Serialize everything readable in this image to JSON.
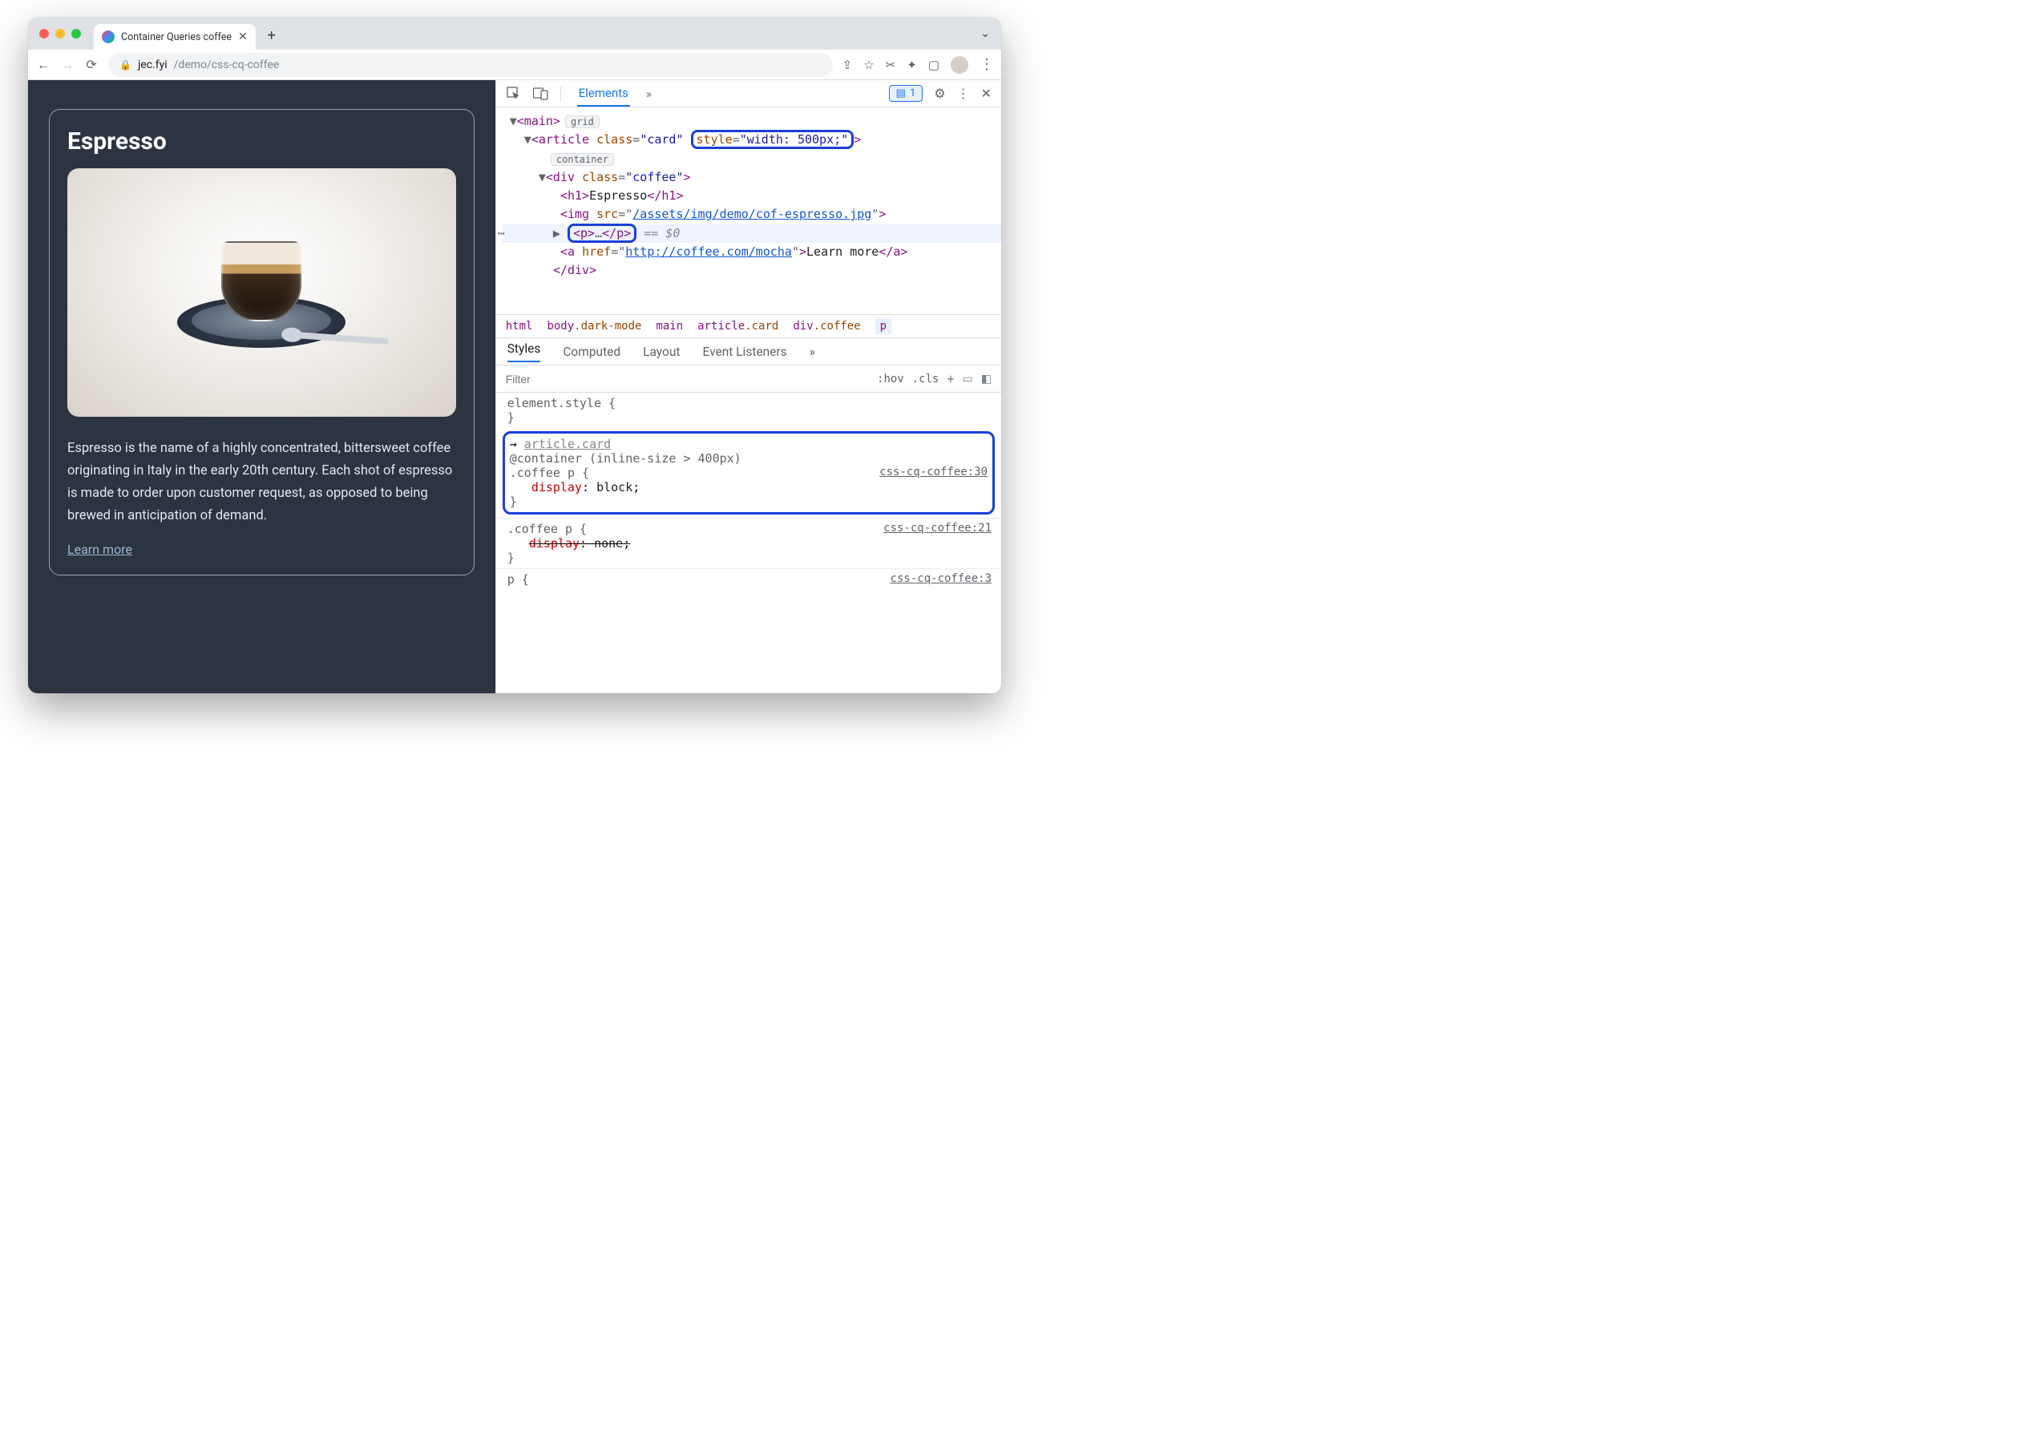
{
  "browser": {
    "tab_title": "Container Queries coffee",
    "url_host": "jec.fyi",
    "url_path": "/demo/css-cq-coffee"
  },
  "page": {
    "card_title": "Espresso",
    "card_body": "Espresso is the name of a highly concentrated, bittersweet coffee originating in Italy in the early 20th century. Each shot of espresso is made to order upon customer request, as opposed to being brewed in anticipation of demand.",
    "learn_more": "Learn more"
  },
  "devtools": {
    "panel_tab": "Elements",
    "issues_count": "1",
    "dom": {
      "main_open": "<main>",
      "grid_badge": "grid",
      "article_open_1": "<article ",
      "article_class_n": "class",
      "article_class_v": "\"card\"",
      "article_style": "style=\"width: 500px;\"",
      "article_open_2": ">",
      "container_badge": "container",
      "div_open": "<div class=\"coffee\">",
      "h1": "<h1>Espresso</h1>",
      "img_1": "<img src=\"",
      "img_href": "/assets/img/demo/cof-espresso.jpg",
      "img_2": "\">",
      "p_collapsed": "<p>…</p>",
      "eq_dollar": " == $0",
      "a_1": "<a href=\"",
      "a_href": "http://coffee.com/mocha",
      "a_2": "\">Learn more</a>",
      "div_close": "</div>"
    },
    "crumbs": {
      "c1": "html",
      "c2_a": "body",
      "c2_b": ".dark-mode",
      "c3": "main",
      "c4_a": "article",
      "c4_b": ".card",
      "c5_a": "div",
      "c5_b": ".coffee",
      "c6": "p"
    },
    "styles_tabs": {
      "t1": "Styles",
      "t2": "Computed",
      "t3": "Layout",
      "t4": "Event Listeners"
    },
    "filter_placeholder": "Filter",
    "hov": ":hov",
    "cls": ".cls",
    "rules": {
      "elstyle_open": "element.style {",
      "close": "}",
      "cq_inherit": "article.card",
      "cq_query": "@container (inline-size > 400px)",
      "cq_sel": ".coffee p {",
      "cq_prop": "display",
      "cq_val": "block",
      "cq_src": "css-cq-coffee:30",
      "ov_sel": ".coffee p {",
      "ov_prop": "display",
      "ov_val": "none",
      "ov_src": "css-cq-coffee:21",
      "p_sel": "p {",
      "p_src": "css-cq-coffee:3"
    }
  }
}
